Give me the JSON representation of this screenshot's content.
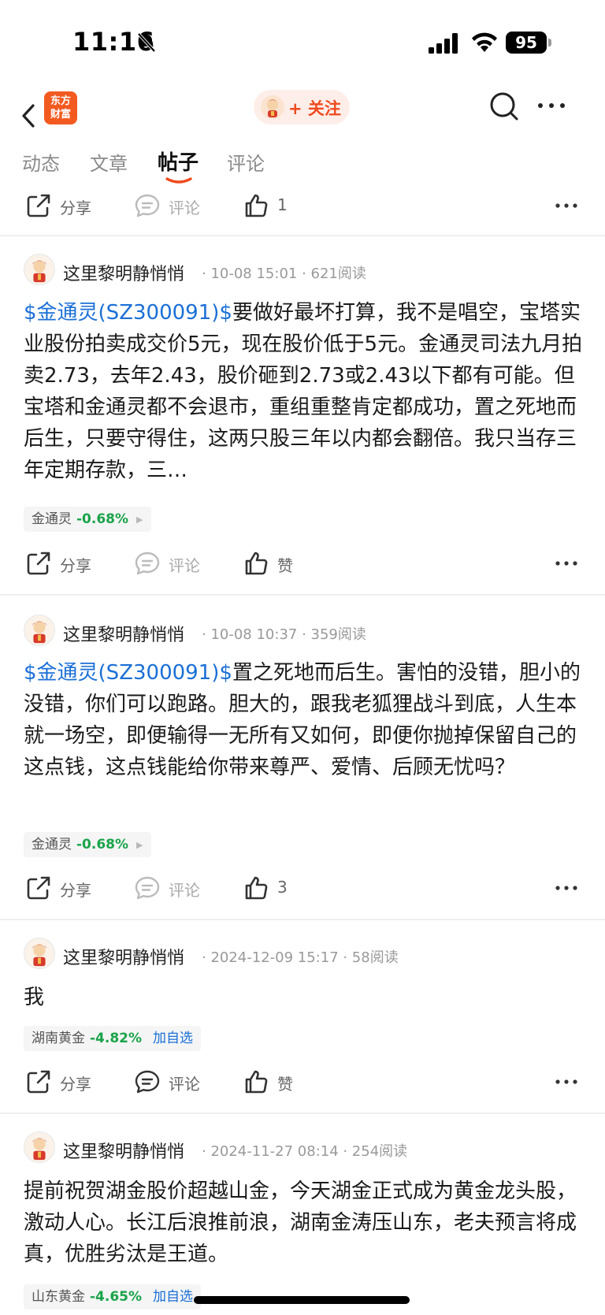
{
  "status_bar": {
    "time": "11:16",
    "battery": "95"
  },
  "nav": {
    "logo_line1": "东方",
    "logo_line2": "财富",
    "follow_label": "+ 关注"
  },
  "tabs": [
    "动态",
    "文章",
    "帖子",
    "评论"
  ],
  "active_tab": 2,
  "top_actions": {
    "share": "分享",
    "comment": "评论",
    "like": "1"
  },
  "posts": [
    {
      "author": "这里黎明静悄悄",
      "meta": "· 10-08 15:01 · 621阅读",
      "tag": "$金通灵(SZ300091)$",
      "body": "要做好最坏打算，我不是唱空，宝塔实业股份拍卖成交价5元，现在股价低于5元。金通灵司法九月拍卖2.73，去年2.43，股价砸到2.73或2.43以下都有可能。但宝塔和金通灵都不会退市，重组重整肯定都成功，置之死地而后生，只要守得住，这两只股三年以内都会翻倍。我只当存三年定期存款，三…",
      "stock": {
        "name": "金通灵",
        "change": "-0.68%",
        "add": ""
      },
      "actions": {
        "share": "分享",
        "comment": "评论",
        "like": "赞"
      }
    },
    {
      "author": "这里黎明静悄悄",
      "meta": "· 10-08 10:37 · 359阅读",
      "tag": "$金通灵(SZ300091)$",
      "body": "置之死地而后生。害怕的没错，胆小的没错，你们可以跑路。胆大的，跟我老狐狸战斗到底，人生本就一场空，即便输得一无所有又如何，即便你抛掉保留自己的这点钱，这点钱能给你带来尊严、爱情、后顾无忧吗？",
      "stock": {
        "name": "金通灵",
        "change": "-0.68%",
        "add": ""
      },
      "actions": {
        "share": "分享",
        "comment": "评论",
        "like": "3"
      }
    },
    {
      "author": "这里黎明静悄悄",
      "meta": "· 2024-12-09 15:17 · 58阅读",
      "tag": "",
      "body": "我",
      "stock": {
        "name": "湖南黄金",
        "change": "-4.82%",
        "add": "加自选"
      },
      "actions": {
        "share": "分享",
        "comment": "评论",
        "like": "赞"
      }
    },
    {
      "author": "这里黎明静悄悄",
      "meta": "· 2024-11-27 08:14 · 254阅读",
      "tag": "",
      "body": "提前祝贺湖金股价超越山金，今天湖金正式成为黄金龙头股，激动人心。长江后浪推前浪，湖南金涛压山东，老夫预言将成真，优胜劣汰是王道。",
      "stock": {
        "name": "山东黄金",
        "change": "-4.65%",
        "add": "加自选"
      }
    }
  ]
}
